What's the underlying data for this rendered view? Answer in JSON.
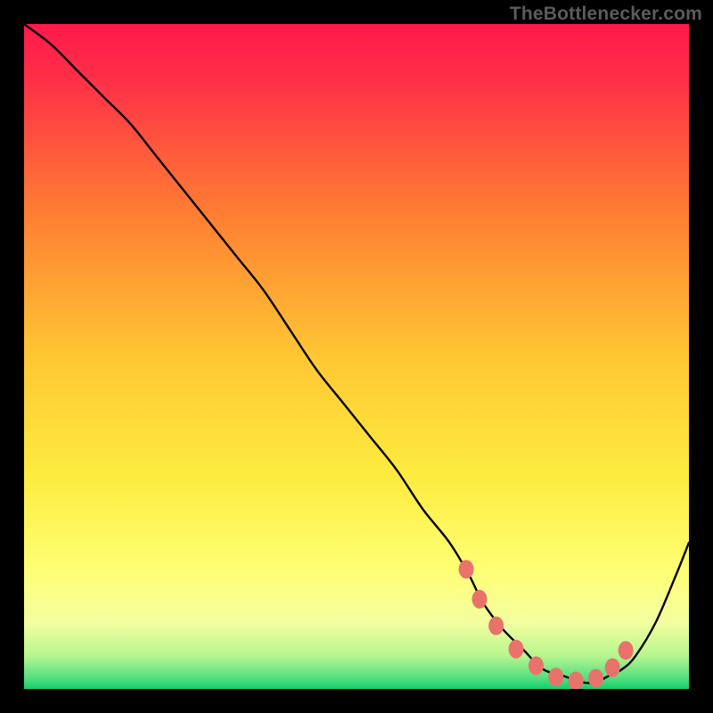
{
  "watermark": "TheBottlenecker.com",
  "chart_data": {
    "type": "line",
    "title": "",
    "xlabel": "",
    "ylabel": "",
    "xlim": [
      0,
      100
    ],
    "ylim": [
      0,
      100
    ],
    "legend": false,
    "grid": false,
    "background_gradient": {
      "top": "#ff1a4b",
      "mid_upper": "#ff9a2a",
      "mid": "#ffe23a",
      "mid_lower": "#ffff6a",
      "bottom": "#16d06c"
    },
    "series": [
      {
        "name": "bottleneck-curve",
        "x": [
          0,
          4,
          8,
          12,
          16,
          20,
          24,
          28,
          32,
          36,
          40,
          44,
          48,
          52,
          56,
          60,
          64,
          67,
          69,
          72,
          75,
          78,
          81,
          84,
          86,
          88,
          90,
          92,
          95,
          98,
          100
        ],
        "values": [
          100,
          97,
          93,
          89,
          85,
          80,
          75,
          70,
          65,
          60,
          54,
          48,
          43,
          38,
          33,
          27,
          22,
          17,
          13,
          9,
          6,
          3,
          2,
          1,
          1,
          2,
          3,
          5,
          10,
          17,
          22
        ]
      }
    ],
    "markers": {
      "name": "optimal-range-dots",
      "color": "#e9736b",
      "x": [
        66.5,
        68.5,
        71,
        74,
        77,
        80,
        83,
        86,
        88.5,
        90.5
      ],
      "values": [
        18,
        13.5,
        9.5,
        6,
        3.5,
        1.8,
        1.2,
        1.6,
        3.2,
        5.8
      ]
    }
  }
}
